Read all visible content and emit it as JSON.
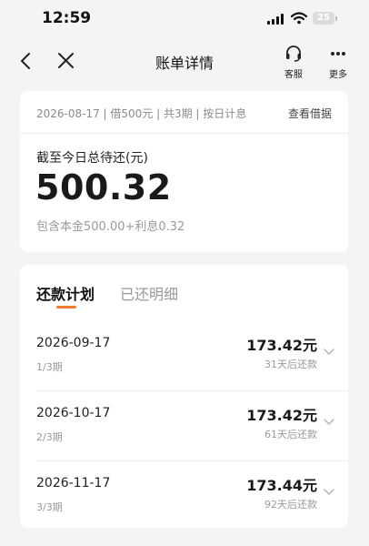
{
  "status_bar": {
    "time": "12:59",
    "battery": "25"
  },
  "nav": {
    "title": "账单详情",
    "service_label": "客服",
    "more_label": "更多"
  },
  "summary": {
    "meta": "2026-08-17 | 借500元 | 共3期 | 按日计息",
    "view_loan": "查看借据",
    "due_label": "截至今日总待还(元)",
    "due_amount": "500.32",
    "breakdown": "包含本金500.00+利息0.32"
  },
  "tabs": {
    "plan": "还款计划",
    "paid": "已还明细"
  },
  "installments": [
    {
      "date": "2026-09-17",
      "period": "1/3期",
      "amount": "173.42元",
      "countdown": "31天后还款"
    },
    {
      "date": "2026-10-17",
      "period": "2/3期",
      "amount": "173.42元",
      "countdown": "61天后还款"
    },
    {
      "date": "2026-11-17",
      "period": "3/3期",
      "amount": "173.44元",
      "countdown": "92天后还款"
    }
  ],
  "colors": {
    "accent": "#f07c2e",
    "background": "#f4f4f6"
  }
}
